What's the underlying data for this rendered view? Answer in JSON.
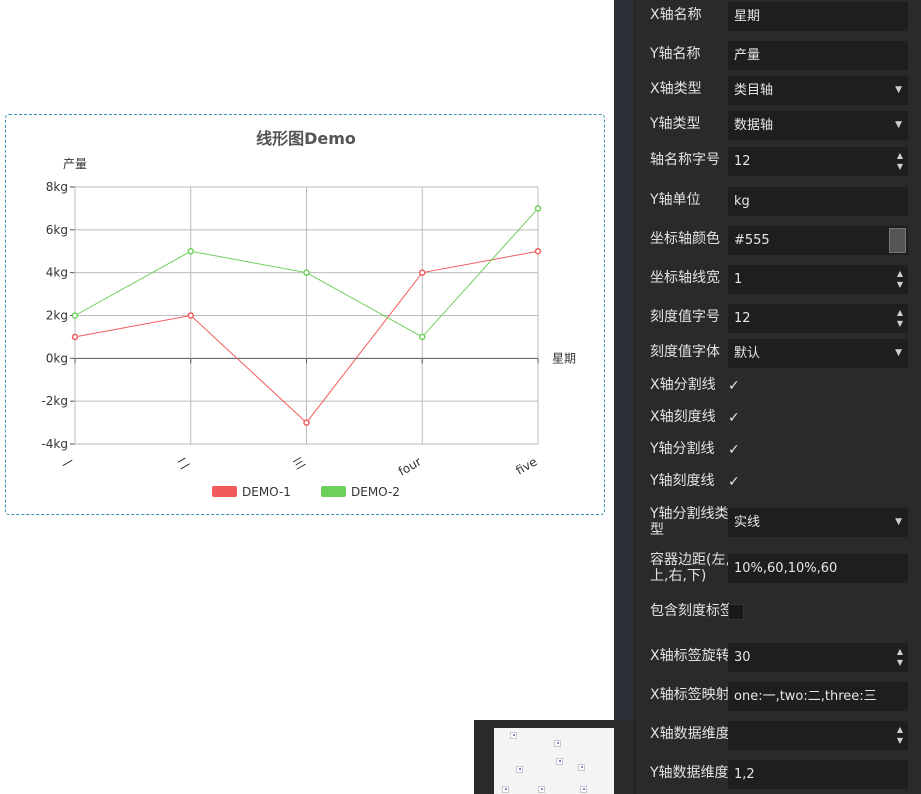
{
  "chart_data": {
    "type": "line",
    "title": "线形图Demo",
    "xlabel": "星期",
    "ylabel": "产量",
    "y_unit": "kg",
    "categories": [
      "一",
      "二",
      "三",
      "four",
      "five"
    ],
    "ylim": [
      -4,
      8
    ],
    "ytick_values": [
      -4,
      -2,
      0,
      2,
      4,
      6,
      8
    ],
    "yticks": [
      "-4kg",
      "-2kg",
      "0kg",
      "2kg",
      "4kg",
      "6kg",
      "8kg"
    ],
    "grid": true,
    "legend_position": "bottom",
    "series": [
      {
        "name": "DEMO-1",
        "color": "#f15b5b",
        "values": [
          1,
          2,
          -3,
          4,
          5
        ]
      },
      {
        "name": "DEMO-2",
        "color": "#6fcf5b",
        "values": [
          2,
          5,
          4,
          1,
          7
        ]
      }
    ]
  },
  "panel": {
    "rows": [
      {
        "label": "X轴名称",
        "type": "text",
        "value": "星期"
      },
      {
        "label": "Y轴名称",
        "type": "text",
        "value": "产量"
      },
      {
        "label": "X轴类型",
        "type": "select",
        "value": "类目轴"
      },
      {
        "label": "Y轴类型",
        "type": "select",
        "value": "数据轴"
      },
      {
        "label": "轴名称字号",
        "type": "number",
        "value": "12"
      },
      {
        "label": "Y轴单位",
        "type": "text",
        "value": "kg"
      },
      {
        "label": "坐标轴颜色",
        "type": "color",
        "value": "#555"
      },
      {
        "label": "坐标轴线宽",
        "type": "number",
        "value": "1"
      },
      {
        "label": "刻度值字号",
        "type": "number",
        "value": "12"
      },
      {
        "label": "刻度值字体",
        "type": "select",
        "value": "默认"
      },
      {
        "label": "X轴分割线",
        "type": "checkbox",
        "checked": true
      },
      {
        "label": "X轴刻度线",
        "type": "checkbox",
        "checked": true
      },
      {
        "label": "Y轴分割线",
        "type": "checkbox",
        "checked": true
      },
      {
        "label": "Y轴刻度线",
        "type": "checkbox",
        "checked": true
      },
      {
        "label": "Y轴分割线类型",
        "type": "select",
        "value": "实线"
      },
      {
        "label": "容器边距(左,上,右,下)",
        "type": "text",
        "value": "10%,60,10%,60"
      },
      {
        "label": "包含刻度标签",
        "type": "checkbox",
        "checked": false
      },
      {
        "label": "X轴标签旋转",
        "type": "number",
        "value": "30"
      },
      {
        "label": "X轴标签映射",
        "type": "text",
        "value": "one:一,two:二,three:三"
      },
      {
        "label": "X轴数据维度",
        "type": "number",
        "value": ""
      },
      {
        "label": "Y轴数据维度",
        "type": "text",
        "value": "1,2"
      }
    ]
  }
}
